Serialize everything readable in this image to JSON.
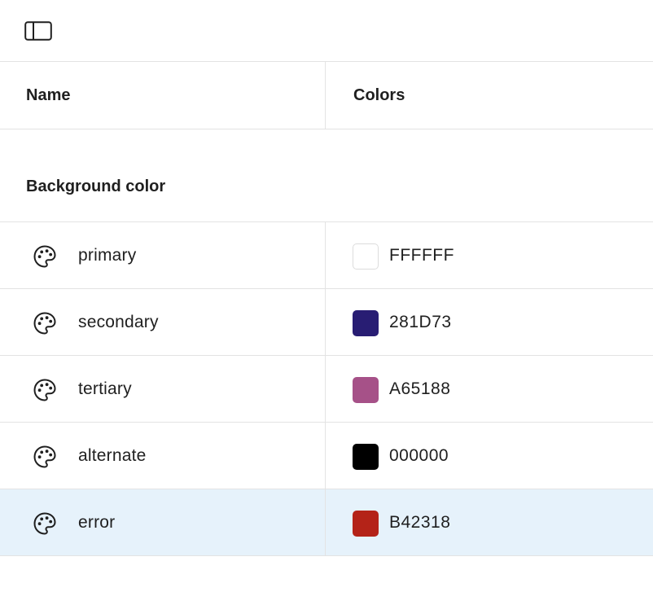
{
  "toolbar": {
    "sidebar_toggle_icon": "sidebar-toggle-icon"
  },
  "table": {
    "headers": {
      "name": "Name",
      "colors": "Colors"
    }
  },
  "section": {
    "title": "Background color",
    "row_icon": "palette-icon",
    "rows": [
      {
        "name": "primary",
        "hex": "FFFFFF",
        "color": "#FFFFFF",
        "selected": false
      },
      {
        "name": "secondary",
        "hex": "281D73",
        "color": "#281D73",
        "selected": false
      },
      {
        "name": "tertiary",
        "hex": "A65188",
        "color": "#A65188",
        "selected": false
      },
      {
        "name": "alternate",
        "hex": "000000",
        "color": "#000000",
        "selected": false
      },
      {
        "name": "error",
        "hex": "B42318",
        "color": "#B42318",
        "selected": true
      }
    ]
  },
  "colors": {
    "selected_row_bg": "#E6F2FB",
    "border": "#E3E3E3"
  }
}
